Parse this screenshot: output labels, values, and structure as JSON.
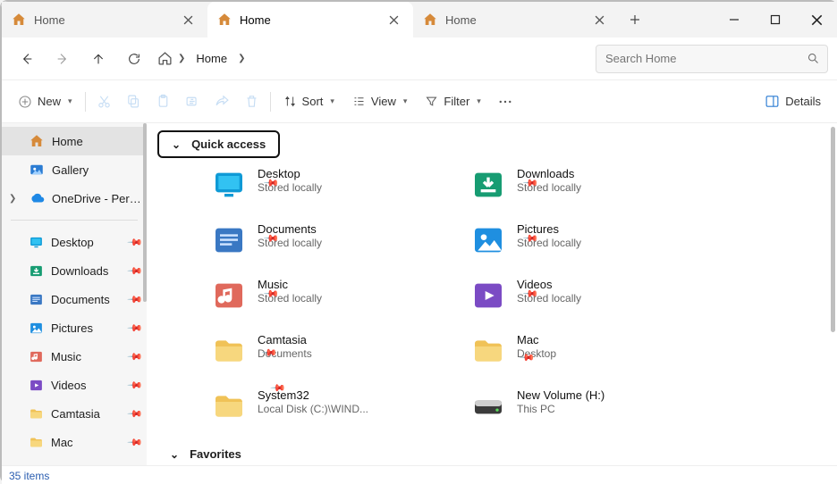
{
  "tabs": [
    {
      "label": "Home",
      "active": false
    },
    {
      "label": "Home",
      "active": true
    },
    {
      "label": "Home",
      "active": false
    }
  ],
  "breadcrumb": {
    "segment": "Home"
  },
  "search": {
    "placeholder": "Search Home"
  },
  "toolbar": {
    "new": "New",
    "sort": "Sort",
    "view": "View",
    "filter": "Filter",
    "details": "Details"
  },
  "nav": {
    "primary": [
      {
        "label": "Home",
        "icon": "home",
        "selected": true
      },
      {
        "label": "Gallery",
        "icon": "gallery"
      },
      {
        "label": "OneDrive - Personal",
        "icon": "onedrive",
        "expandable": true
      }
    ],
    "pinned": [
      {
        "label": "Desktop",
        "icon": "desktop"
      },
      {
        "label": "Downloads",
        "icon": "download"
      },
      {
        "label": "Documents",
        "icon": "document"
      },
      {
        "label": "Pictures",
        "icon": "pictures"
      },
      {
        "label": "Music",
        "icon": "music"
      },
      {
        "label": "Videos",
        "icon": "videos"
      },
      {
        "label": "Camtasia",
        "icon": "folder"
      },
      {
        "label": "Mac",
        "icon": "folder"
      }
    ]
  },
  "sections": {
    "quick_access": {
      "title": "Quick access"
    },
    "favorites": {
      "title": "Favorites"
    }
  },
  "quick_items_left": [
    {
      "name": "Desktop",
      "sub": "Stored locally",
      "icon": "desktop",
      "pinned": true
    },
    {
      "name": "Documents",
      "sub": "Stored locally",
      "icon": "document",
      "pinned": true
    },
    {
      "name": "Music",
      "sub": "Stored locally",
      "icon": "music",
      "pinned": true
    },
    {
      "name": "Camtasia",
      "sub": "Documents",
      "icon": "folder",
      "pinned": true
    },
    {
      "name": "System32",
      "sub": "Local Disk (C:)\\WIND...",
      "icon": "folder",
      "pinned": true
    }
  ],
  "quick_items_right": [
    {
      "name": "Downloads",
      "sub": "Stored locally",
      "icon": "download",
      "pinned": true
    },
    {
      "name": "Pictures",
      "sub": "Stored locally",
      "icon": "pictures",
      "pinned": true
    },
    {
      "name": "Videos",
      "sub": "Stored locally",
      "icon": "videos",
      "pinned": true
    },
    {
      "name": "Mac",
      "sub": "Desktop",
      "icon": "folder",
      "pinned": true
    },
    {
      "name": "New Volume (H:)",
      "sub": "This PC",
      "icon": "drive",
      "pinned": false
    }
  ],
  "status": {
    "text": "35 items"
  }
}
